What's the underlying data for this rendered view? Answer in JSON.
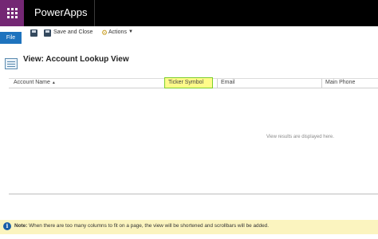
{
  "app": {
    "title": "PowerApps"
  },
  "cmdbar": {
    "file_label": "File",
    "save_close_label": "Save and Close",
    "actions_label": "Actions"
  },
  "view": {
    "title": "View: Account Lookup View"
  },
  "grid": {
    "columns": [
      {
        "label": "Account Name",
        "sorted": "asc"
      },
      {
        "label": "Ticker Symbol",
        "highlighted": true
      },
      {
        "label": "Email"
      },
      {
        "label": "Main Phone"
      }
    ],
    "empty_message": "View results are displayed here."
  },
  "note": {
    "label": "Note:",
    "text": "When there are too many columns to fit on a page, the view will be shortened and scrollbars will be added."
  },
  "colors": {
    "topbar": "#000000",
    "waffle": "#742774",
    "file_button": "#1e73be",
    "highlight_fill": "#fffb8a",
    "highlight_border": "#7ccf2c",
    "note_bar": "#fbf4bf"
  },
  "icons": {
    "waffle": "app-launcher-icon",
    "save": "save-icon",
    "save_close": "save-close-icon",
    "actions": "actions-icon",
    "view": "view-icon",
    "info": "info-icon"
  }
}
